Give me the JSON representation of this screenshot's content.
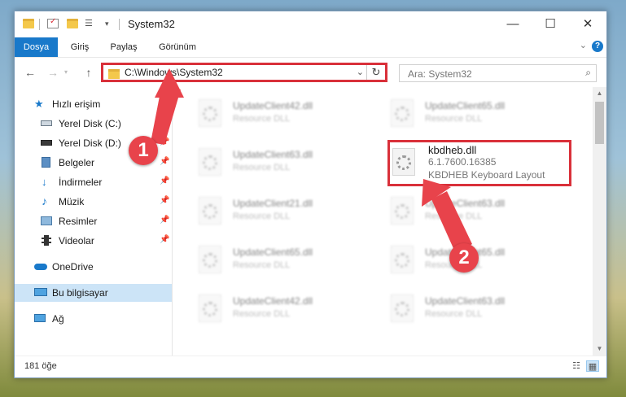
{
  "window": {
    "title": "System32",
    "controls": {
      "minimize": "—",
      "maximize": "☐",
      "close": "✕"
    }
  },
  "ribbon": {
    "tabs": [
      {
        "label": "Dosya"
      },
      {
        "label": "Giriş"
      },
      {
        "label": "Paylaş"
      },
      {
        "label": "Görünüm"
      }
    ],
    "help": "?"
  },
  "navigation": {
    "back": "←",
    "forward": "→",
    "up": "↑",
    "address": "C:\\Windows\\System32",
    "search_placeholder": "Ara: System32"
  },
  "sidebar": {
    "items": [
      {
        "label": "Hızlı erişim",
        "icon": "star-icon"
      },
      {
        "label": "Yerel Disk (C:)",
        "icon": "drive-icon",
        "pinned": true
      },
      {
        "label": "Yerel Disk (D:)",
        "icon": "drive-icon",
        "pinned": true
      },
      {
        "label": "Belgeler",
        "icon": "documents-icon",
        "pinned": true
      },
      {
        "label": "İndirmeler",
        "icon": "download-icon",
        "pinned": true
      },
      {
        "label": "Müzik",
        "icon": "music-icon",
        "pinned": true
      },
      {
        "label": "Resimler",
        "icon": "pictures-icon",
        "pinned": true
      },
      {
        "label": "Videolar",
        "icon": "video-icon",
        "pinned": true
      },
      {
        "label": "OneDrive",
        "icon": "cloud-icon"
      },
      {
        "label": "Bu bilgisayar",
        "icon": "computer-icon",
        "selected": true
      },
      {
        "label": "Ağ",
        "icon": "network-icon"
      }
    ]
  },
  "files": [
    {
      "name": "UpdateClient42.dll",
      "desc": "Resource DLL"
    },
    {
      "name": "UpdateClient65.dll",
      "desc": "Resource DLL"
    },
    {
      "name": "UpdateClient63.dll",
      "desc": "Resource DLL"
    },
    {
      "name": "kbdheb.dll",
      "version": "6.1.7600.16385",
      "desc": "KBDHEB Keyboard Layout",
      "highlighted": true
    },
    {
      "name": "UpdateClient21.dll",
      "desc": "Resource DLL"
    },
    {
      "name": "UpdateClient63.dll",
      "desc": "Resource DLL"
    },
    {
      "name": "UpdateClient65.dll",
      "desc": "Resource DLL"
    },
    {
      "name": "UpdateClient65.dll",
      "desc": "Resource DLL"
    },
    {
      "name": "UpdateClient42.dll",
      "desc": "Resource DLL"
    },
    {
      "name": "UpdateClient63.dll",
      "desc": "Resource DLL"
    }
  ],
  "status": {
    "item_count": "181 öğe"
  },
  "callouts": {
    "one": "1",
    "two": "2"
  },
  "colors": {
    "accent": "#1979ca",
    "highlight": "#d9303a",
    "callout": "#e8434b",
    "selection": "#cce4f7"
  }
}
